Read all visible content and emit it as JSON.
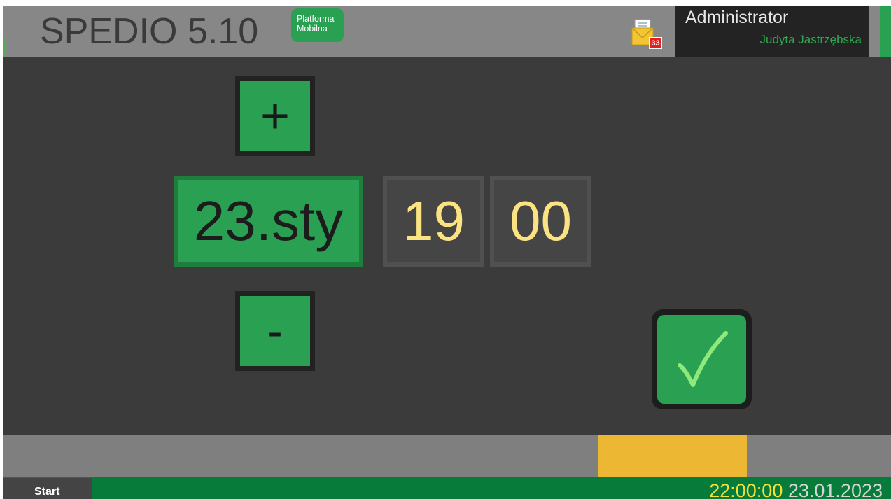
{
  "header": {
    "app_title": "SPEDIO 5.10",
    "badge_line1": "Platforma",
    "badge_line2": "Mobilna",
    "mail_icon": "mail-icon",
    "mail_count": "33",
    "user_role": "Administrator",
    "user_name": "Judyta Jastrzębska"
  },
  "editor": {
    "increment_label": "+",
    "decrement_label": "-",
    "date_value": "23.sty",
    "hour_value": "19",
    "minute_value": "00",
    "confirm_icon": "checkmark-icon"
  },
  "taskbar": {
    "start_label": "Start",
    "time": "22:00:00",
    "date": "23.01.2023"
  },
  "colors": {
    "accent_green": "#2aa152",
    "taskbar_green": "#077c3a",
    "time_digits": "#fbe382",
    "highlight_yellow": "#ecb833",
    "background": "#3b3b3b"
  }
}
